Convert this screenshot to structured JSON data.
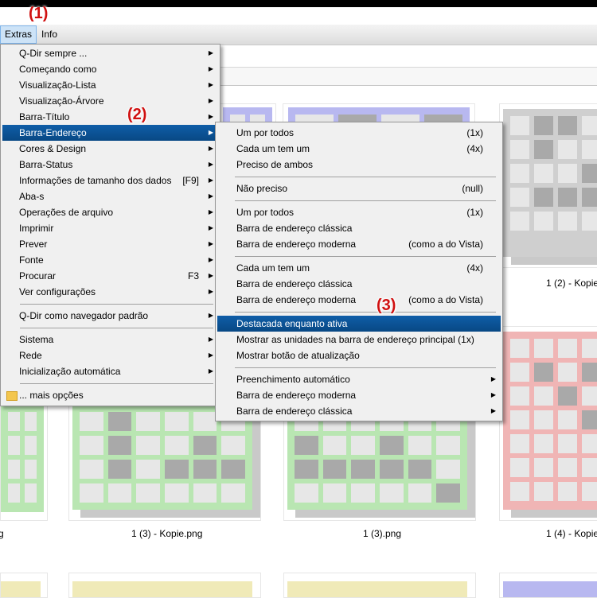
{
  "menubar": {
    "items": [
      {
        "label": "Extras",
        "active": true
      },
      {
        "label": "Info",
        "active": false
      }
    ]
  },
  "annotations": [
    "(1)",
    "(2)",
    "(3)"
  ],
  "main_menu": {
    "items": [
      {
        "label": "Q-Dir sempre ...",
        "arrow": "▶"
      },
      {
        "label": "Começando como",
        "arrow": "▶"
      },
      {
        "label": "Visualização-Lista",
        "arrow": "▶"
      },
      {
        "label": "Visualização-Árvore",
        "arrow": "▶"
      },
      {
        "label": "Barra-Título",
        "arrow": "▶"
      },
      {
        "label": "Barra-Endereço",
        "arrow": "▶",
        "highlighted": true
      },
      {
        "label": "Cores & Design",
        "arrow": "▶"
      },
      {
        "label": "Barra-Status",
        "arrow": "▶"
      },
      {
        "label": "Informações de tamanho dos dados",
        "shortcut": "[F9]",
        "arrow": "▶"
      },
      {
        "label": "Aba-s",
        "arrow": "▶"
      },
      {
        "label": "Operações de arquivo",
        "arrow": "▶"
      },
      {
        "label": "Imprimir",
        "arrow": "▶"
      },
      {
        "label": "Prever",
        "arrow": "▶"
      },
      {
        "label": "Fonte",
        "arrow": "▶"
      },
      {
        "label": "Procurar",
        "shortcut": "F3",
        "arrow": "▶"
      },
      {
        "label": "Ver configurações",
        "arrow": "▶"
      },
      {
        "label": "Q-Dir como navegador padrão",
        "arrow": "▶"
      },
      {
        "label": "Sistema",
        "arrow": "▶"
      },
      {
        "label": "Rede",
        "arrow": "▶"
      },
      {
        "label": "Inicialização automática",
        "arrow": "▶"
      },
      {
        "label": "... mais opções",
        "icon": "folder-icon"
      }
    ]
  },
  "submenu": {
    "items": [
      {
        "label": "Um por todos",
        "shortcut": "(1x)"
      },
      {
        "label": "Cada um tem um",
        "shortcut": "(4x)"
      },
      {
        "label": "Preciso de ambos",
        "shortcut": ""
      },
      {
        "label": "Não preciso",
        "shortcut": "(null)"
      },
      {
        "label": "Um por todos",
        "shortcut": "(1x)"
      },
      {
        "label": "Barra de endereço clássica",
        "shortcut": ""
      },
      {
        "label": "Barra de endereço moderna",
        "shortcut": "(como a do Vista)"
      },
      {
        "label": "Cada um tem um",
        "shortcut": "(4x)"
      },
      {
        "label": "Barra de endereço clássica",
        "shortcut": ""
      },
      {
        "label": "Barra de endereço moderna",
        "shortcut": "(como a do Vista)"
      },
      {
        "label": "Destacada enquanto ativa",
        "shortcut": "",
        "highlighted": true
      },
      {
        "label": "Mostrar as unidades na barra de endereço principal (1x)",
        "shortcut": ""
      },
      {
        "label": "Mostrar botão de atualização",
        "shortcut": ""
      },
      {
        "label": "Preenchimento automático",
        "arrow": "▶"
      },
      {
        "label": "Barra de endereço moderna",
        "arrow": "▶"
      },
      {
        "label": "Barra de endereço clássica",
        "arrow": "▶"
      }
    ]
  },
  "thumbnails": {
    "captions": [
      "1 (2) - Kopie",
      "g",
      "1 (3) - Kopie.png",
      "1 (3).png",
      "1 (4) - Kopie"
    ],
    "colors": {
      "blue": "#b8b8f0",
      "gray": "#cfcfcf",
      "green": "#b9e6b2",
      "red": "#f0b5b5",
      "yellow": "#f0eab8"
    }
  }
}
